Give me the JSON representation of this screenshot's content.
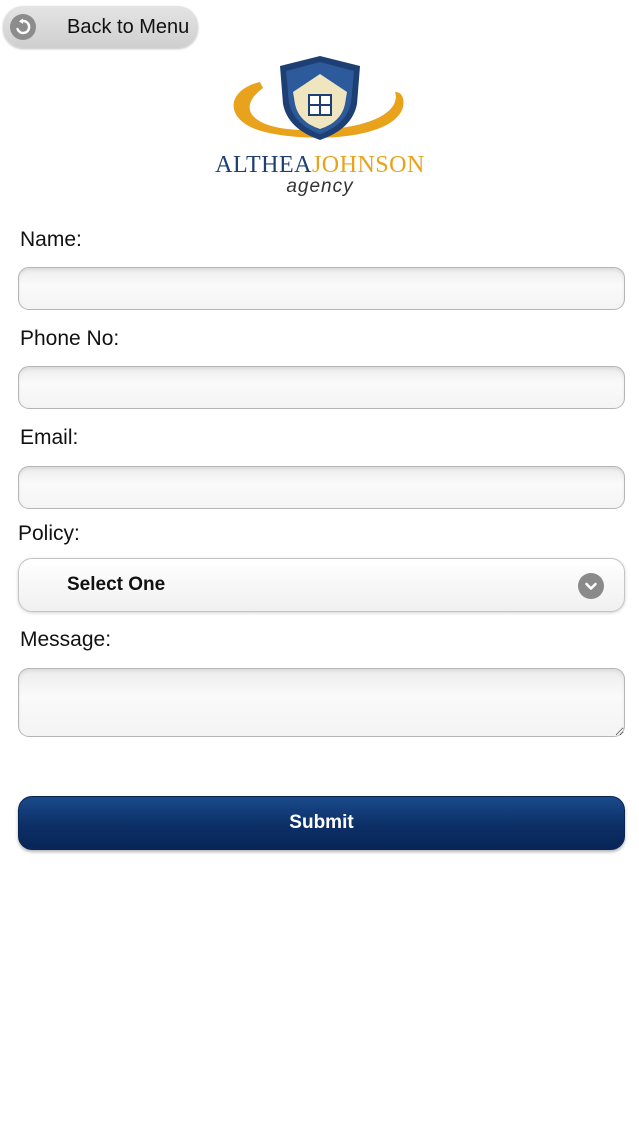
{
  "header": {
    "back_label": "Back to Menu",
    "back_icon": "back-arrow-icon"
  },
  "logo": {
    "name_part_1": "ALTHEA",
    "name_part_2": "JOHNSON",
    "subtitle": "agency",
    "colors": {
      "navy": "#1e3f73",
      "gold": "#e8a21b",
      "cream": "#efe6c0"
    }
  },
  "form": {
    "name_label": "Name:",
    "name_value": "",
    "phone_label": "Phone No:",
    "phone_value": "",
    "email_label": "Email:",
    "email_value": "",
    "policy_label": "Policy:",
    "policy_selected": "Select One",
    "policy_icon": "chevron-down-icon",
    "message_label": "Message:",
    "message_value": "",
    "submit_label": "Submit"
  },
  "colors": {
    "submit_bg": "#0c2f66",
    "field_border": "#b5b5b5"
  }
}
